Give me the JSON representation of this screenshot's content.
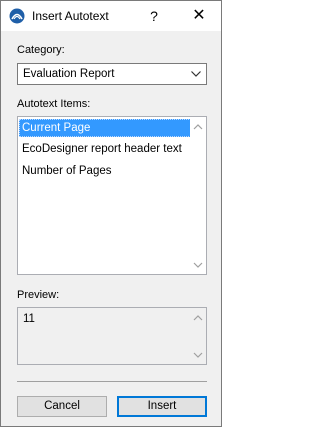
{
  "window": {
    "title": "Insert Autotext",
    "help_label": "?",
    "close_label": "✕",
    "icon": "archicad-logo-icon"
  },
  "category": {
    "label": "Category:",
    "selected": "Evaluation Report"
  },
  "autotext": {
    "label": "Autotext Items:",
    "items": [
      {
        "label": "Current Page",
        "selected": true
      },
      {
        "label": "EcoDesigner report header text",
        "selected": false
      },
      {
        "label": "Number of Pages",
        "selected": false
      }
    ]
  },
  "preview": {
    "label": "Preview:",
    "value": "11"
  },
  "buttons": {
    "cancel": "Cancel",
    "insert": "Insert"
  },
  "colors": {
    "selection": "#3399ff",
    "default_button_border": "#0078d7",
    "dialog_background": "#f0f0f0"
  }
}
